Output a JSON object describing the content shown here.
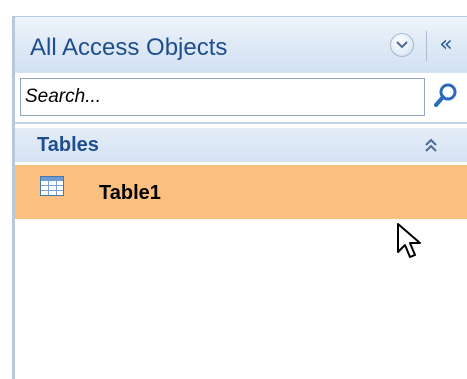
{
  "nav_pane": {
    "title": "All Access Objects",
    "dropdown_icon": "chevron-down-circle-icon",
    "collapse_label": "«",
    "search": {
      "placeholder": "Search...",
      "value": ""
    },
    "groups": [
      {
        "label": "Tables",
        "toggle_icon": "double-chevron-up-icon",
        "items": [
          {
            "label": "Table1",
            "icon": "table-icon",
            "selected": true
          }
        ]
      }
    ]
  },
  "colors": {
    "header_text": "#1f4e8c",
    "selected_row": "#fbc07f",
    "pane_border": "#b7c8dc"
  }
}
